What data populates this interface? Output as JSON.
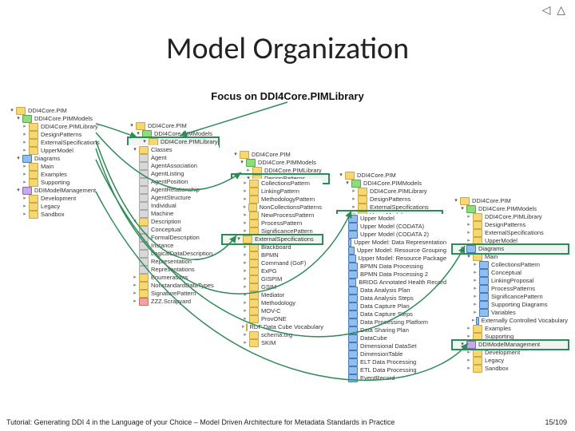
{
  "title": "Model Organization",
  "focus_label": "Focus on DDI4Core.PIMLibrary",
  "footer": "Tutorial: Generating DDI 4 in the Language of your Choice – Model Driven Architecture for Metadata Standards in Practice",
  "page": "15/109",
  "nav_glyphs": "◁ △",
  "tree1": {
    "root": "DDI4Core.PIM",
    "items": [
      "DDI4Core.PIMModels",
      "DDI4Core.PIMLibrary",
      "DesignPatterns",
      "ExternalSpecifications",
      "UpperModel"
    ],
    "diagrams": [
      "Main",
      "Examples",
      "Supporting"
    ],
    "mgmt": [
      "Development",
      "Legacy",
      "Sandbox"
    ],
    "diagrams_label": "Diagrams",
    "mgmt_label": "DDIModelManagement"
  },
  "tree1_header": {
    "root": "DDI4Core.PIM",
    "sub": "DDI4Core.PIMModels",
    "hl": "DDI4Core.PIMLibrary"
  },
  "tree2": {
    "root": "DDI4Core.PIMLibrary",
    "classes_label": "Classes",
    "classes": [
      "Agent",
      "AgentAssociation",
      "AgentListing",
      "AgentPosition",
      "AgentRelationship",
      "AgentStructure",
      "Individual",
      "Machine"
    ],
    "section2": "Description",
    "section2_items": [
      "Conceptual",
      "FormalDescription",
      "Instance",
      "LogicalDataDescription",
      "Representation",
      "Representations"
    ],
    "section3": "Enumerations",
    "section4": "NonstandardDataTypes",
    "section5": "SignaturePattern",
    "section6": "ZZZ.Scrapyard"
  },
  "tree2_header": {
    "root": "DDI4Core.PIM",
    "sub": "DDI4Core.PIMModels",
    "hl": "DDI4Core.PIMLibrary"
  },
  "tree3": {
    "root": "DesignPatterns",
    "items": [
      "CollectionsPattern",
      "LinkingPattern",
      "MethodologyPattern",
      "NonCollectionsPatterns",
      "NewProcessPattern",
      "ProcessPattern",
      "SignificancePattern"
    ],
    "ext_label": "ExternalSpecifications",
    "ext": [
      "Blackboard",
      "BPMN",
      "Command (GoF)",
      "ExPG",
      "GISPIM",
      "GSIM",
      "Mediator",
      "Methodology",
      "MOV-C",
      "ProvONE",
      "RDF Data Cube Vocabulary",
      "schema.org",
      "SKIM"
    ]
  },
  "tree3_header": {
    "root": "DDI4Core.PIM",
    "sub": "DDI4Core.PIMModels"
  },
  "tree4": {
    "root": "DDI4Core.PIM",
    "sub": "DDI4Core.PIMModels",
    "items": [
      "DDI4Core.PIMLibrary",
      "DesignPatterns",
      "ExternalSpecifications",
      "UpperModel"
    ],
    "um": [
      "Upper Model",
      "Upper Model (CODATA)",
      "Upper Model (CODATA 2)",
      "Upper Model: Data Representation",
      "Upper Model: Resource Grouping",
      "Upper Model: Resource Package",
      "BPMN Data Processing",
      "BPMN Data Processing 2",
      "BRIDG Annotated Health Record",
      "Data Analysis Plan",
      "Data Analysis Steps",
      "Data Capture Plan",
      "Data Capture Steps",
      "Data Processing Platform",
      "Data Sharing Plan",
      "DataCube",
      "Dimensional DataSet",
      "DimensionTable",
      "ELT Data Processing",
      "ETL Data Processing",
      "EventRecord"
    ]
  },
  "tree5": {
    "root": "DDI4Core.PIM",
    "sub": "DDI4Core.PIMModels",
    "items": [
      "DDI4Core.PIMLibrary",
      "DesignPatterns",
      "ExternalSpecifications",
      "UpperModel"
    ],
    "diagrams_label": "Diagrams",
    "diagrams_main": "Main",
    "diag_groups": [
      "CollectionsPattern",
      "Conceptual",
      "LinkingProposal",
      "ProcessPatterns",
      "SignificancePattern",
      "Supporting Diagrams",
      "Variables",
      "Externally Controlled Vocabulary"
    ],
    "examples": "Examples",
    "supporting": "Supporting",
    "mgmt_label": "DDIModelManagement",
    "mgmt": [
      "Development",
      "Legacy",
      "Sandbox"
    ]
  }
}
